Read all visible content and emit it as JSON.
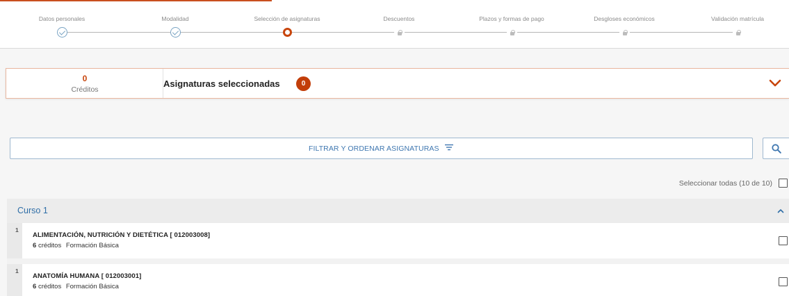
{
  "stepper": {
    "steps": [
      {
        "label": "Datos personales",
        "state": "done"
      },
      {
        "label": "Modalidad",
        "state": "done"
      },
      {
        "label": "Selección de asignaturas",
        "state": "current"
      },
      {
        "label": "Descuentos",
        "state": "locked"
      },
      {
        "label": "Plazos y formas de pago",
        "state": "locked"
      },
      {
        "label": "Desgloses económicos",
        "state": "locked"
      },
      {
        "label": "Validación matrícula",
        "state": "locked"
      }
    ]
  },
  "selected": {
    "credits_value": "0",
    "credits_label": "Créditos",
    "title": "Asignaturas seleccionadas",
    "count": "0"
  },
  "filter": {
    "label": "FILTRAR Y ORDENAR ASIGNATURAS"
  },
  "select_all": {
    "label": "Seleccionar todas (10 de 10)"
  },
  "course": {
    "title": "Curso 1",
    "subjects": [
      {
        "index": "1",
        "name": "ALIMENTACIÓN, NUTRICIÓN Y DIETÉTICA [ 012003008]",
        "credits": "6",
        "credits_unit": "créditos",
        "type": "Formación Básica"
      },
      {
        "index": "1",
        "name": "ANATOMÍA HUMANA [ 012003001]",
        "credits": "6",
        "credits_unit": "créditos",
        "type": "Formación Básica"
      }
    ]
  },
  "colors": {
    "accent": "#c8450c",
    "link": "#3f77b0",
    "done": "#7aa4c4"
  },
  "icons": [
    "check-icon",
    "current-step-icon",
    "lock-icon",
    "chevron-down-icon",
    "filter-icon",
    "search-icon",
    "chevron-up-icon",
    "checkbox-icon"
  ]
}
